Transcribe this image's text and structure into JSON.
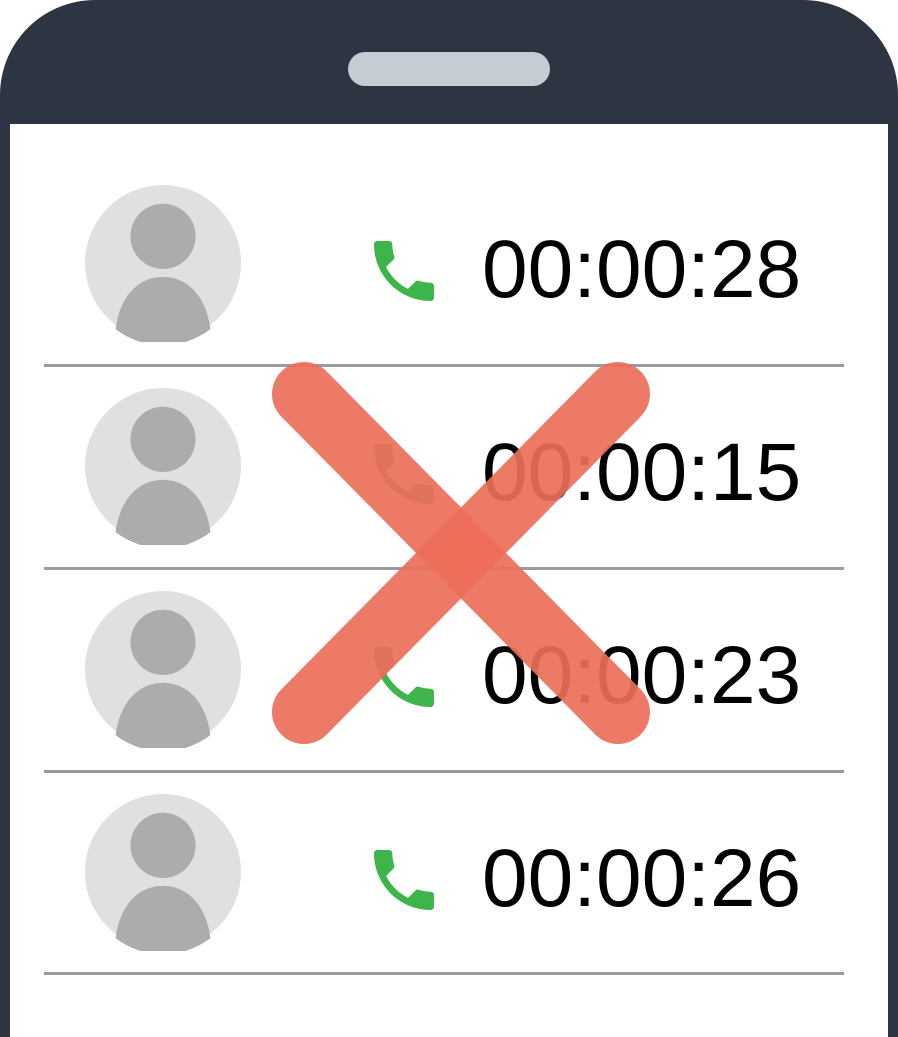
{
  "call_log": {
    "entries": [
      {
        "duration": "00:00:28"
      },
      {
        "duration": "00:00:15"
      },
      {
        "duration": "00:00:23"
      },
      {
        "duration": "00:00:26"
      }
    ]
  },
  "icons": {
    "avatar": "user-avatar-icon",
    "call": "phone-handset-icon",
    "cross": "red-x-cross-icon"
  },
  "colors": {
    "phone_frame": "#2e3542",
    "speaker": "#c5ccd4",
    "avatar_bg": "#e0e0e0",
    "avatar_figure": "#acacac",
    "call_icon": "#3db54a",
    "cross": "#ec6e5a",
    "divider": "#9b9b9b"
  }
}
